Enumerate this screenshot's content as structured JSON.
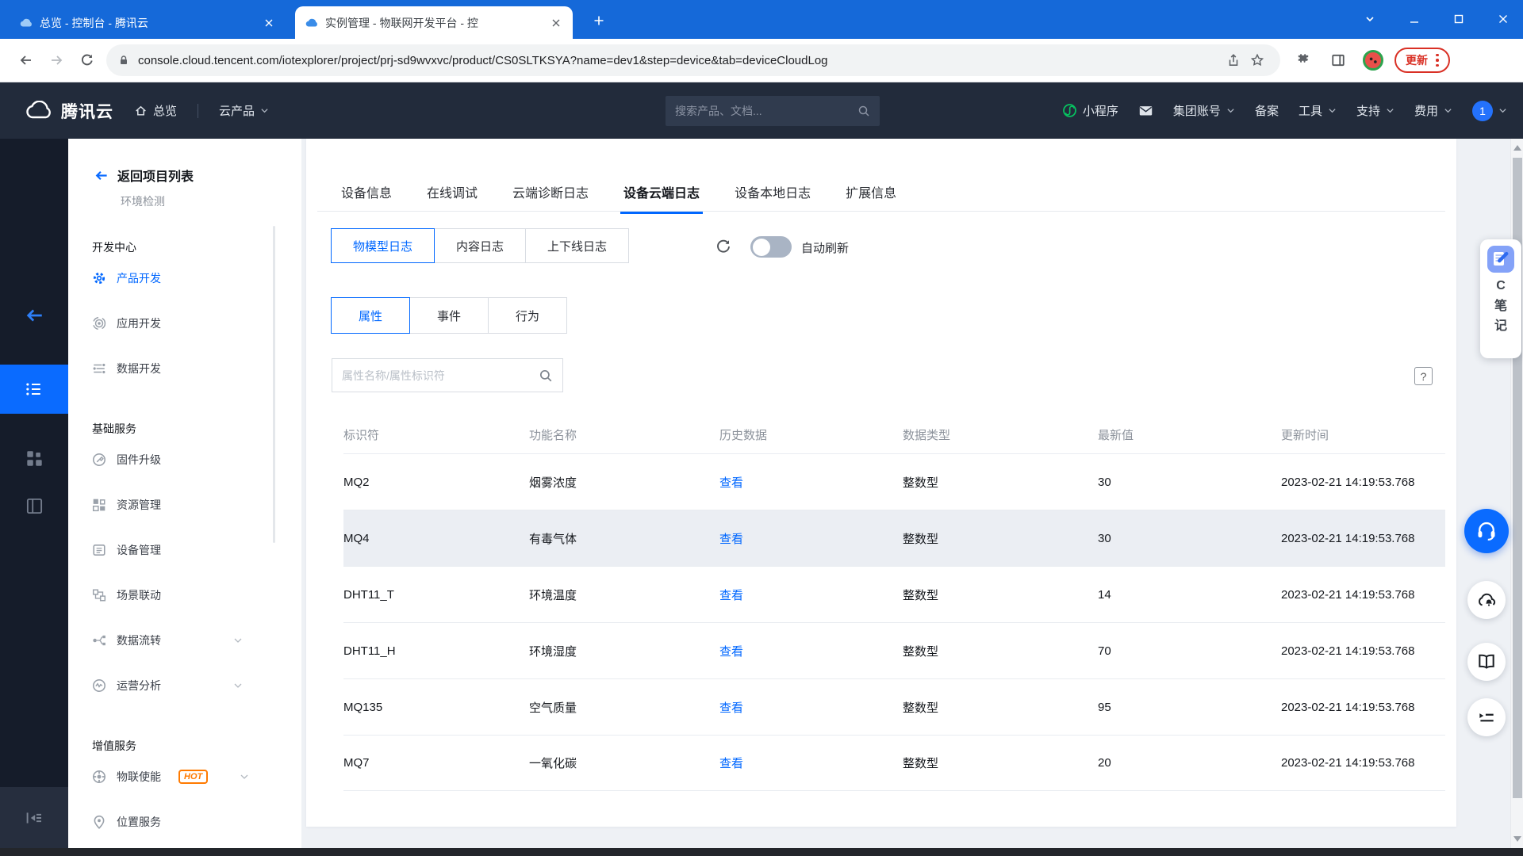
{
  "colors": {
    "accent": "#006eff",
    "chrome_frame": "#1569d9",
    "topnav_bg": "#222b3b",
    "rail_bg": "#151c2a",
    "hot": "#ff7a00",
    "link": "#0067ff",
    "danger": "#d93025",
    "row_highlight": "#ebeef3"
  },
  "browser": {
    "tabs": [
      {
        "title": "总览 - 控制台 - 腾讯云",
        "active": false
      },
      {
        "title": "实例管理 - 物联网开发平台 - 控",
        "active": true
      }
    ],
    "url": "console.cloud.tencent.com/iotexplorer/project/prj-sd9wvxvc/product/CS0SLTKSYA?name=dev1&step=device&tab=deviceCloudLog",
    "update_label": "更新"
  },
  "topnav": {
    "brand": "腾讯云",
    "overview_label": "总览",
    "products_label": "云产品",
    "search_placeholder": "搜索产品、文档...",
    "miniprogram_label": "小程序",
    "group_label": "集团账号",
    "beian_label": "备案",
    "tools_label": "工具",
    "support_label": "支持",
    "billing_label": "费用",
    "user_badge": "1"
  },
  "sidebar": {
    "back_label": "返回项目列表",
    "project_name": "环境检测",
    "hot_badge": "HOT",
    "sections": [
      {
        "title": "开发中心",
        "items": [
          {
            "label": "产品开发",
            "icon": "gear-icon",
            "active": true
          },
          {
            "label": "应用开发",
            "icon": "target-icon"
          },
          {
            "label": "数据开发",
            "icon": "streams-icon"
          }
        ]
      },
      {
        "title": "基础服务",
        "items": [
          {
            "label": "固件升级",
            "icon": "firmware-icon"
          },
          {
            "label": "资源管理",
            "icon": "blocks-icon"
          },
          {
            "label": "设备管理",
            "icon": "device-card-icon"
          },
          {
            "label": "场景联动",
            "icon": "scene-link-icon"
          },
          {
            "label": "数据流转",
            "icon": "flow-branch-icon",
            "expandable": true
          },
          {
            "label": "运营分析",
            "icon": "analytics-pulse-icon",
            "expandable": true
          }
        ]
      },
      {
        "title": "增值服务",
        "items": [
          {
            "label": "物联使能",
            "icon": "iot-enable-icon",
            "hot": true,
            "expandable": true
          },
          {
            "label": "位置服务",
            "icon": "location-pin-icon"
          }
        ]
      }
    ]
  },
  "main": {
    "tabs": [
      "设备信息",
      "在线调试",
      "云端诊断日志",
      "设备云端日志",
      "设备本地日志",
      "扩展信息"
    ],
    "active_tab": "设备云端日志",
    "log_tabs": [
      "物模型日志",
      "内容日志",
      "上下线日志"
    ],
    "active_log_tab": "物模型日志",
    "auto_refresh_label": "自动刷新",
    "auto_refresh_on": false,
    "filter_tabs": [
      "属性",
      "事件",
      "行为"
    ],
    "active_filter_tab": "属性",
    "search_placeholder": "属性名称/属性标识符",
    "help_label": "?",
    "table": {
      "columns": [
        "标识符",
        "功能名称",
        "历史数据",
        "数据类型",
        "最新值",
        "更新时间"
      ],
      "view_label": "查看",
      "rows": [
        {
          "id": "MQ2",
          "name": "烟雾浓度",
          "type": "整数型",
          "value": "30",
          "time": "2023-02-21 14:19:53.768",
          "highlight": false
        },
        {
          "id": "MQ4",
          "name": "有毒气体",
          "type": "整数型",
          "value": "30",
          "time": "2023-02-21 14:19:53.768",
          "highlight": true
        },
        {
          "id": "DHT11_T",
          "name": "环境温度",
          "type": "整数型",
          "value": "14",
          "time": "2023-02-21 14:19:53.768",
          "highlight": false
        },
        {
          "id": "DHT11_H",
          "name": "环境湿度",
          "type": "整数型",
          "value": "70",
          "time": "2023-02-21 14:19:53.768",
          "highlight": false
        },
        {
          "id": "MQ135",
          "name": "空气质量",
          "type": "整数型",
          "value": "95",
          "time": "2023-02-21 14:19:53.768",
          "highlight": false
        },
        {
          "id": "MQ7",
          "name": "一氧化碳",
          "type": "整数型",
          "value": "20",
          "time": "2023-02-21 14:19:53.768",
          "highlight": false
        }
      ]
    }
  },
  "floating": {
    "notes_letters": [
      "C",
      "笔",
      "记"
    ]
  }
}
